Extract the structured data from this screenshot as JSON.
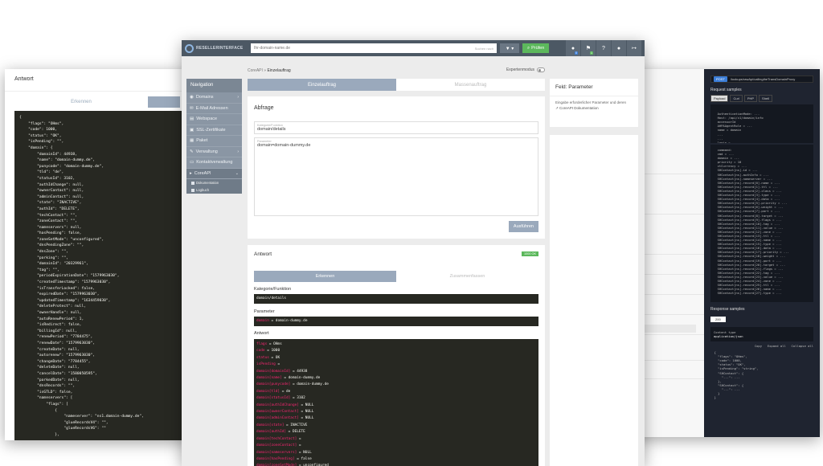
{
  "left_panel": {
    "header": "Antwort",
    "tabs": [
      "Erkennen",
      ""
    ],
    "code_lines": [
      "{",
      "    \"flags\": \"OHms\",",
      "    \"code\": 1000,",
      "    \"status\": \"OK\",",
      "    \"isPending\": \"\",",
      "    \"domain\": {",
      "        \"domainId\": 44938,",
      "        \"name\": \"domain-dummy.de\",",
      "        \"punycode\": \"domain-dummy.de\",",
      "        \"tld\": \"de\",",
      "        \"statusId\": 3102,",
      "        \"authIdChange\": null,",
      "        \"ownerContact\": null,",
      "        \"adminContact\": null,",
      "        \"state\": \"INACTIVE\",",
      "        \"authId\": \"DELETE\",",
      "        \"techContact\": \"\",",
      "        \"zoneContact\": \"\",",
      "        \"nameservers\": null,",
      "        \"hasPending\": false,",
      "        \"zoneSetMode\": \"unconfigured\",",
      "        \"dnsPendingZone\": \"\",",
      "        \"dnsZone\": \"\",",
      "        \"parking\": \"\",",
      "        \"domainId\": \"20329961\",",
      "        \"tag\": \"\",",
      "        \"periodExpirationDate\": \"1579963030\",",
      "        \"createdTimestamp\": \"1579963030\",",
      "        \"isTransferLocked\": false,",
      "        \"expiredDate\": \"1579963030\",",
      "        \"updatedTimestamp\": \"1634459030\",",
      "        \"deleteProtect\": null,",
      "        \"ownerHandle\": null,",
      "        \"autoRenewPeriod\": 1,",
      "        \"isRedirect\": false,",
      "        \"billingId\": null,",
      "        \"renewPeriod\": \"7784475\",",
      "        \"renewDate\": \"1579963030\",",
      "        \"createDate\": null,",
      "        \"autorenew\": \"1579963030\",",
      "        \"changeDate\": \"7784455\",",
      "        \"deleteDate\": null,",
      "        \"cancelDate\": \"1580050595\",",
      "        \"parkedDate\": null,",
      "        \"dnsRecords\": \"\",",
      "        \"isGTLD\": false,",
      "        \"nameservers\": [",
      "            \"flags\": [",
      "                {",
      "                    \"nameserver\": \"ns1.domain-dummy.de\",",
      "                    \"glueRecordsV4\": \"\",",
      "                    \"glueRecordsV6\": \"\"",
      "                },"
    ]
  },
  "right_panel": {
    "url_method": "POST",
    "url_path": "/lookups/rawApi/callingtheTransDomainProxy",
    "request_label": "Request samples",
    "request_tabs": [
      "Payload",
      "Curl",
      "PHP",
      "Shell"
    ],
    "request_code": [
      "                                                           Copy",
      "  AuthenticationMode: ...",
      "  Host: /api/v1/domain/info",
      "",
      "  accessorId",
      "  AHPAAgentRole = ...",
      "  name = domain",
      "  ...",
      "  ...",
      "  login =",
      "  password = ..."
    ],
    "request_code2": [
      "  command:",
      "  cmd = ...",
      "  domain = ...",
      "  priority = 10",
      "  ctCurrency = ...",
      "  SHContact[ns].id = ...",
      "  SHContact[ns].authInfo = ...",
      "  SHContact[ns].nameserver = ...",
      "  SHContact[ns].record[0].name = ...",
      "  SHContact[ns].record[1].ttl = ...",
      "  SHContact[ns].record[2].class = ...",
      "  SHContact[ns].record[3].type = ...",
      "  SHContact[ns].record[4].data = ...",
      "  SHContact[ns].record[5].priority = ...",
      "  SHContact[ns].record[6].weight = ...",
      "  SHContact[ns].record[7].port = ...",
      "  SHContact[ns].record[8].target = ...",
      "  SHContact[ns].record[9].flags = ...",
      "  SHContact[ns].record[10].tag = ...",
      "  SHContact[ns].record[11].value = ...",
      "  SHContact[ns].record[12].zone = ...",
      "  SHContact[ns].record[13].ttl = ...",
      "  SHContact[ns].record[14].name = ...",
      "  SHContact[ns].record[15].type = ...",
      "  SHContact[ns].record[16].data = ...",
      "  SHContact[ns].record[17].priority = ...",
      "  SHContact[ns].record[18].weight = ...",
      "  SHContact[ns].record[19].port = ...",
      "  SHContact[ns].record[20].target = ...",
      "  SHContact[ns].record[21].flags = ...",
      "  SHContact[ns].record[22].tag = ...",
      "  SHContact[ns].record[23].value = ...",
      "  SHContact[ns].record[24].zone = ...",
      "  SHContact[ns].record[25].ttl = ...",
      "  SHContact[ns].record[26].name = ...",
      "  SHContact[ns].record[27].type = ..."
    ],
    "response_label": "Response samples",
    "response_button": "200",
    "content_type_label": "Content type",
    "content_type": "application/json",
    "response_actions": "Copy   Expand all   Collapse all",
    "response_code": [
      "  {",
      "    \"flags\": \"OHms\",",
      "    \"code\": 1000,",
      "    \"status\": \"OK\",",
      "    \"isPending\": \"string\",",
      "    \"SHContact\": {",
      "      \"...\": ...",
      "    },",
      "    \"SHContact\": {",
      "      \"...\": ...",
      "    }",
      "  }"
    ]
  },
  "main": {
    "logo": "RESELLERINTERFACE",
    "search_placeholder": "Ihr-domain-name.de",
    "search_hint": "Suchen nach",
    "filter_icon": "funnel-icon",
    "check_button": "Prüfen",
    "top_icons": [
      {
        "icon": "cart-icon",
        "glyph": "●",
        "badge": "0",
        "badge_color": "#3b7dd8"
      },
      {
        "icon": "flag-icon",
        "glyph": "⚑",
        "badge": "1",
        "badge_color": "#5cb85c"
      },
      {
        "icon": "help-icon",
        "glyph": "?",
        "badge": "",
        "badge_color": ""
      },
      {
        "icon": "user-icon",
        "glyph": "●",
        "badge": "",
        "badge_color": ""
      },
      {
        "icon": "logout-icon",
        "glyph": "↦",
        "badge": "",
        "badge_color": ""
      }
    ],
    "breadcrumb_root": "CoreAPI",
    "breadcrumb_current": "Einzelauftrag",
    "expert_mode_label": "Expertenmodus",
    "nav": {
      "title": "Navigation",
      "items": [
        {
          "label": "Domains",
          "icon": "globe-icon",
          "chevron": "›"
        },
        {
          "label": "E-Mail Adressen",
          "icon": "mail-icon",
          "chevron": ""
        },
        {
          "label": "Webspace",
          "icon": "server-icon",
          "chevron": ""
        },
        {
          "label": "SSL-Zertifikate",
          "icon": "lock-icon",
          "chevron": ""
        },
        {
          "label": "Paket",
          "icon": "box-icon",
          "chevron": ""
        },
        {
          "label": "Verwaltung",
          "icon": "wrench-icon",
          "chevron": "›"
        },
        {
          "label": "Kontaktverwaltung",
          "icon": "card-icon",
          "chevron": ""
        },
        {
          "label": "CoreAPI",
          "icon": "code-icon",
          "chevron": "⌄"
        }
      ],
      "subitems": [
        "Dokumentation",
        "Logbuch"
      ]
    },
    "tabs": [
      "Einzelauftrag",
      "Massenauftrag"
    ],
    "query": {
      "title": "Abfrage",
      "field1_label": "Kategorie/Funktion",
      "field1_value": "domain/details",
      "field2_label": "Parameter",
      "field2_value": "domain=domain-dummy.de",
      "run_button": "Ausführen"
    },
    "answer": {
      "title": "Antwort",
      "status_badge": "1000 OK",
      "tabs": [
        "Erkennen",
        "Zusammenfassen"
      ],
      "cat_label": "Kategorie/Funktion",
      "cat_value": "domain/details",
      "param_label": "Parameter",
      "param_key": "domain",
      "param_value": " = domain-dummy.de",
      "response_label": "Antwort",
      "lines": [
        [
          "flags",
          " = OHms"
        ],
        [
          "code",
          " = 1000"
        ],
        [
          "status",
          " = OK"
        ],
        [
          "isPending",
          " = "
        ],
        [
          "domain[domainId]",
          " = 44938"
        ],
        [
          "domain[name]",
          " = domain-dummy.de"
        ],
        [
          "domain[punycode]",
          " = domain-dummy.de"
        ],
        [
          "domain[tld]",
          " = de"
        ],
        [
          "domain[statusId]",
          " = 3102"
        ],
        [
          "domain[authIdChange]",
          " = NULL"
        ],
        [
          "domain[ownerContact]",
          " = NULL"
        ],
        [
          "domain[adminContact]",
          " = NULL"
        ],
        [
          "domain[state]",
          " = INACTIVE"
        ],
        [
          "domain[authId]",
          " = DELETE"
        ],
        [
          "domain[techContact]",
          " = "
        ],
        [
          "domain[zoneContact]",
          " = "
        ],
        [
          "domain[nameservers]",
          " = NULL"
        ],
        [
          "domain[hasPending]",
          " = false"
        ],
        [
          "domain[zoneSetMode]",
          " = unconfigured"
        ],
        [
          "domain[dnsPendingZone]",
          " = "
        ]
      ]
    },
    "help": {
      "title": "Feld: Parameter",
      "text": "Eingabe erforderlicher Parameter und deren",
      "link": "CoreAPI Dokumentation"
    }
  }
}
